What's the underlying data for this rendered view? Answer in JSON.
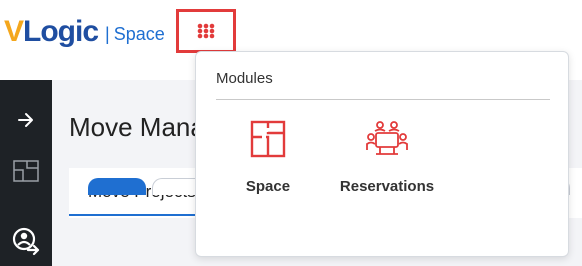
{
  "header": {
    "logo_v": "V",
    "logo_text": "Logic",
    "separator": "|",
    "product": "Space",
    "modules_icon": "grid-icon"
  },
  "sidebar": {
    "items": [
      {
        "icon": "arrow-right-icon"
      },
      {
        "icon": "floorplan-icon"
      },
      {
        "icon": "person-pin-icon"
      }
    ]
  },
  "main": {
    "title": "Move Management",
    "tabs": [
      {
        "label": "Move Projects"
      }
    ]
  },
  "modules_menu": {
    "title": "Modules",
    "items": [
      {
        "label": "Space",
        "icon": "floorplan-icon"
      },
      {
        "label": "Reservations",
        "icon": "meeting-room-icon"
      }
    ]
  },
  "colors": {
    "accent_red": "#e23b3b",
    "brand_blue": "#1f4ea1",
    "brand_yellow": "#f4a71d",
    "sidebar_bg": "#1e2226"
  }
}
